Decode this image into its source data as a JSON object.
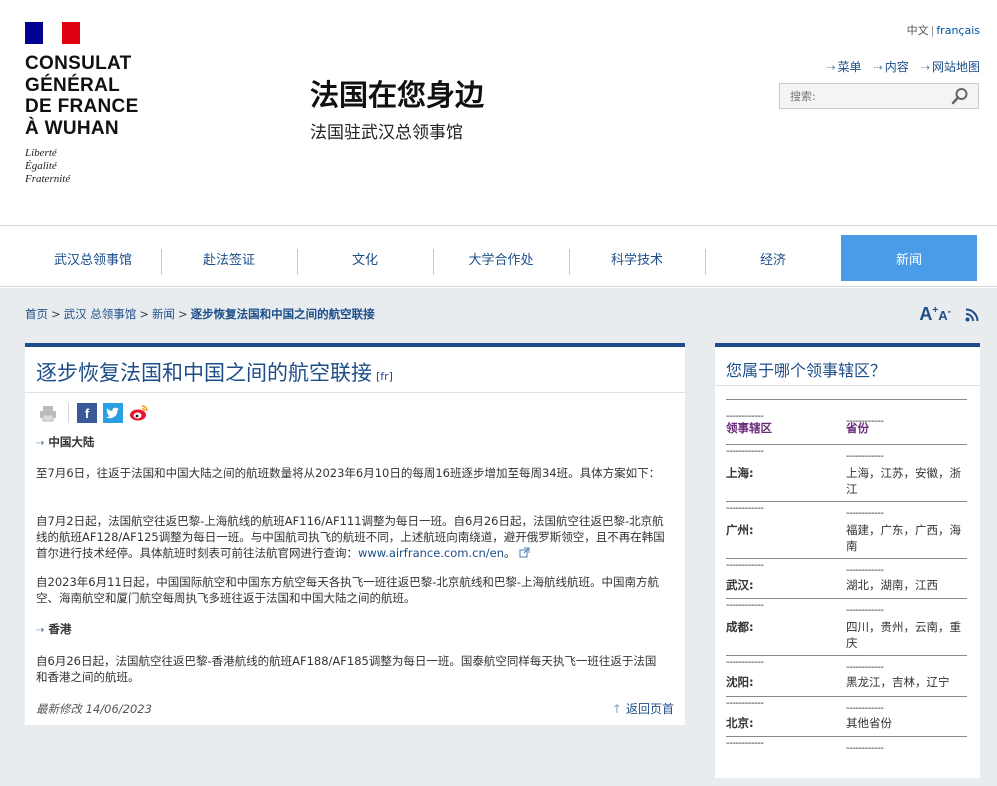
{
  "logo": {
    "lines": [
      "CONSULAT",
      "GÉNÉRAL",
      "DE FRANCE",
      "À WUHAN"
    ],
    "motto": [
      "Liberté",
      "Égalité",
      "Fraternité"
    ]
  },
  "site": {
    "title": "法国在您身边",
    "subtitle": "法国驻武汉总领事馆"
  },
  "lang": {
    "zh": "中文",
    "sep": "|",
    "fr": "français"
  },
  "quicklinks": [
    {
      "label": "菜单"
    },
    {
      "label": "内容"
    },
    {
      "label": "网站地图"
    }
  ],
  "search": {
    "placeholder": "搜索:"
  },
  "nav": [
    "武汉总领事馆",
    "赴法签证",
    "文化",
    "大学合作处",
    "科学技术",
    "经济",
    "新闻"
  ],
  "breadcrumb": [
    "首页",
    "武汉 总领事馆",
    "新闻",
    "逐步恢复法国和中国之间的航空联接"
  ],
  "font_tools": {
    "bigger": "A",
    "plus": "+",
    "smaller": "A",
    "minus": "-"
  },
  "article": {
    "title": "逐步恢复法国和中国之间的航空联接",
    "lang_tag": "[fr]",
    "section1": "中国大陆",
    "p1": "至7月6日，往返于法国和中国大陆之间的航班数量将从2023年6月10日的每周16班逐步增加至每周34班。具体方案如下：",
    "p2": "自7月2日起，法国航空往返巴黎-上海航线的航班AF116/AF111调整为每日一班。自6月26日起，法国航空往返巴黎-北京航线的航班AF128/AF125调整为每日一班。与中国航司执飞的航班不同，上述航班向南绕道，避开俄罗斯领空，且不再在韩国首尔进行技术经停。具体航班时刻表可前往法航官网进行查询：",
    "p2_link": "www.airfrance.com.cn/en",
    "p2_end": "。",
    "p3": "自2023年6月11日起，中国国际航空和中国东方航空每天各执飞一班往返巴黎-北京航线和巴黎-上海航线航班。中国南方航空、海南航空和厦门航空每周执飞多班往返于法国和中国大陆之间的航班。",
    "section2": "香港",
    "p4": "自6月26日起，法国航空往返巴黎-香港航线的航班AF188/AF185调整为每日一班。国泰航空同样每天执飞一班往返于法国和香港之间的航班。",
    "updated": "最新修改 14/06/2023",
    "back_top": "返回页首"
  },
  "sidebar": {
    "title": "您属于哪个领事辖区？",
    "dash": "------------",
    "head1": "领事辖区",
    "head2": "省份",
    "rows": [
      {
        "city": "上海:",
        "prov": "上海，江苏，安徽，浙江"
      },
      {
        "city": "广州:",
        "prov": "福建，广东，广西，海南"
      },
      {
        "city": "武汉:",
        "prov": "湖北，湖南，江西"
      },
      {
        "city": "成都:",
        "prov": "四川，贵州，云南，重庆"
      },
      {
        "city": "沈阳:",
        "prov": "黑龙江，吉林，辽宁"
      },
      {
        "city": "北京:",
        "prov": "其他省份"
      }
    ]
  },
  "colors": {
    "brand_blue": "#1d4e89",
    "active_tab": "#4a9be8",
    "band": "#e8ecef"
  }
}
